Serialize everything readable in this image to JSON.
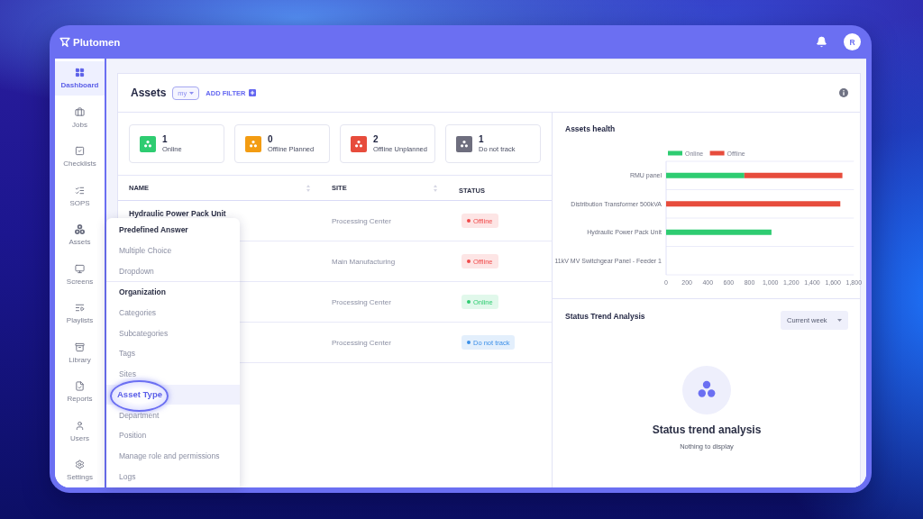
{
  "app": {
    "logo": "Plutomen",
    "avatar": "R"
  },
  "sidebar": {
    "items": [
      {
        "label": "Dashboard",
        "selected": true
      },
      {
        "label": "Jobs",
        "selected": false
      },
      {
        "label": "Checklists",
        "selected": false
      },
      {
        "label": "SOPS",
        "selected": false
      },
      {
        "label": "Assets",
        "selected": false
      },
      {
        "label": "Screens",
        "selected": false
      },
      {
        "label": "Playlists",
        "selected": false
      },
      {
        "label": "Library",
        "selected": false
      },
      {
        "label": "Reports",
        "selected": false
      },
      {
        "label": "Users",
        "selected": false
      },
      {
        "label": "Settings",
        "selected": false
      }
    ]
  },
  "assets": {
    "title": "Assets",
    "filter": "my",
    "add_filter": "ADD FILTER"
  },
  "stats": [
    {
      "count": "1",
      "label": "Online",
      "color": "#2ecc71"
    },
    {
      "count": "0",
      "label": "Offline Planned",
      "color": "#f39c12"
    },
    {
      "count": "2",
      "label": "Offline Unplanned",
      "color": "#e74c3c"
    },
    {
      "count": "1",
      "label": "Do not track",
      "color": "#6e6e7e"
    }
  ],
  "table": {
    "columns": [
      {
        "label": "NAME",
        "sortable": true
      },
      {
        "label": "SITE",
        "sortable": true
      },
      {
        "label": "STATUS",
        "sortable": false
      }
    ],
    "rows": [
      {
        "name": "Hydraulic Power Pack Unit",
        "site": "Processing Center",
        "status": "Offline",
        "color": "#f04a4a"
      },
      {
        "site": "Main Manufacturing",
        "status": "Offline",
        "color": "#f04a4a"
      },
      {
        "site": "Processing Center",
        "status": "Online",
        "color": "#2ecc71"
      },
      {
        "site": "Processing Center",
        "status": "Do not track",
        "color": "#3b8fe8"
      }
    ]
  },
  "assets_health": {
    "title": "Assets health",
    "chart_data": {
      "type": "bar",
      "orientation": "horizontal",
      "stacked": true,
      "legend": "top",
      "categories": [
        "RMU panel",
        "Distribution Transformer 500kVA",
        "Hydraulic Power Pack Unit",
        "11kV MV Switchgear Panel - Feeder 1"
      ],
      "series": [
        {
          "name": "Online",
          "color": "#2ecc71",
          "values": [
            750,
            0,
            1010,
            0
          ]
        },
        {
          "name": "Offline",
          "color": "#e74c3c",
          "values": [
            940,
            1670,
            0,
            0
          ]
        }
      ],
      "xlim": [
        0,
        1800
      ],
      "xticks": [
        0,
        200,
        400,
        600,
        800,
        {
          "value": 1000,
          "label": "1,000"
        },
        {
          "value": 1200,
          "label": "1,200"
        },
        {
          "value": 1400,
          "label": "1,400"
        },
        {
          "value": 1600,
          "label": "1,600"
        },
        {
          "value": 1800,
          "label": "1,800"
        }
      ]
    }
  },
  "status_trend": {
    "title": "Status Trend Analysis",
    "period": "Current week",
    "empty_title": "Status trend analysis",
    "empty_message": "Nothing to display"
  },
  "menu": {
    "sections": [
      {
        "title": "Predefined Answer",
        "items": [
          {
            "label": "Multiple Choice",
            "selected": false
          },
          {
            "label": "Dropdown",
            "selected": false
          }
        ]
      },
      {
        "title": "Organization",
        "items": [
          {
            "label": "Categories",
            "selected": false
          },
          {
            "label": "Subcategories",
            "selected": false
          },
          {
            "label": "Tags",
            "selected": false
          },
          {
            "label": "Sites",
            "selected": false
          },
          {
            "label": "Asset Type",
            "selected": true
          },
          {
            "label": "Department",
            "selected": false
          },
          {
            "label": "Position",
            "selected": false
          },
          {
            "label": "Manage role and permissions",
            "selected": false
          },
          {
            "label": "Logs",
            "selected": false
          }
        ]
      }
    ]
  }
}
